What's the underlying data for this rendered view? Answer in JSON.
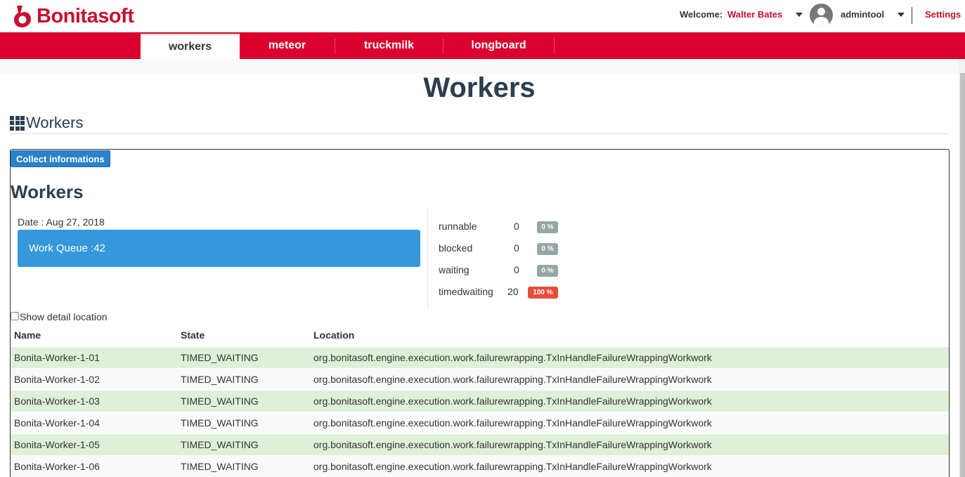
{
  "header": {
    "brand": "Bonitasoft",
    "welcome_label": "Welcome:",
    "user_name": "Walter Bates",
    "profile_name": "admintool",
    "settings_label": "Settings"
  },
  "nav": {
    "tabs": [
      {
        "label": "workers",
        "active": true
      },
      {
        "label": "meteor",
        "active": false
      },
      {
        "label": "truckmilk",
        "active": false
      },
      {
        "label": "longboard",
        "active": false
      }
    ]
  },
  "page": {
    "title": "Workers",
    "section_title": "Workers"
  },
  "panel": {
    "collect_button": "Collect informations",
    "title": "Workers",
    "date": "Date : Aug 27, 2018",
    "work_queue": "Work Queue :42",
    "states": [
      {
        "label": "runnable",
        "count": "0",
        "percent": "0 %",
        "color": "#95a5a6"
      },
      {
        "label": "blocked",
        "count": "0",
        "percent": "0 %",
        "color": "#95a5a6"
      },
      {
        "label": "waiting",
        "count": "0",
        "percent": "0 %",
        "color": "#95a5a6"
      },
      {
        "label": "timedwaiting",
        "count": "20",
        "percent": "100 %",
        "color": "#e74c3c"
      }
    ],
    "show_detail_label": "Show detail location",
    "show_detail_checked": false
  },
  "table": {
    "columns": [
      "Name",
      "State",
      "Location"
    ],
    "rows": [
      {
        "name": "Bonita-Worker-1-01",
        "state": "TIMED_WAITING",
        "location": "org.bonitasoft.engine.execution.work.failurewrapping.TxInHandleFailureWrappingWorkwork"
      },
      {
        "name": "Bonita-Worker-1-02",
        "state": "TIMED_WAITING",
        "location": "org.bonitasoft.engine.execution.work.failurewrapping.TxInHandleFailureWrappingWorkwork"
      },
      {
        "name": "Bonita-Worker-1-03",
        "state": "TIMED_WAITING",
        "location": "org.bonitasoft.engine.execution.work.failurewrapping.TxInHandleFailureWrappingWorkwork"
      },
      {
        "name": "Bonita-Worker-1-04",
        "state": "TIMED_WAITING",
        "location": "org.bonitasoft.engine.execution.work.failurewrapping.TxInHandleFailureWrappingWorkwork"
      },
      {
        "name": "Bonita-Worker-1-05",
        "state": "TIMED_WAITING",
        "location": "org.bonitasoft.engine.execution.work.failurewrapping.TxInHandleFailureWrappingWorkwork"
      },
      {
        "name": "Bonita-Worker-1-06",
        "state": "TIMED_WAITING",
        "location": "org.bonitasoft.engine.execution.work.failurewrapping.TxInHandleFailureWrappingWorkwork"
      }
    ]
  },
  "colors": {
    "brand_red": "#dc002e",
    "primary_blue": "#3498db",
    "row_highlight": "#dff0d8"
  }
}
